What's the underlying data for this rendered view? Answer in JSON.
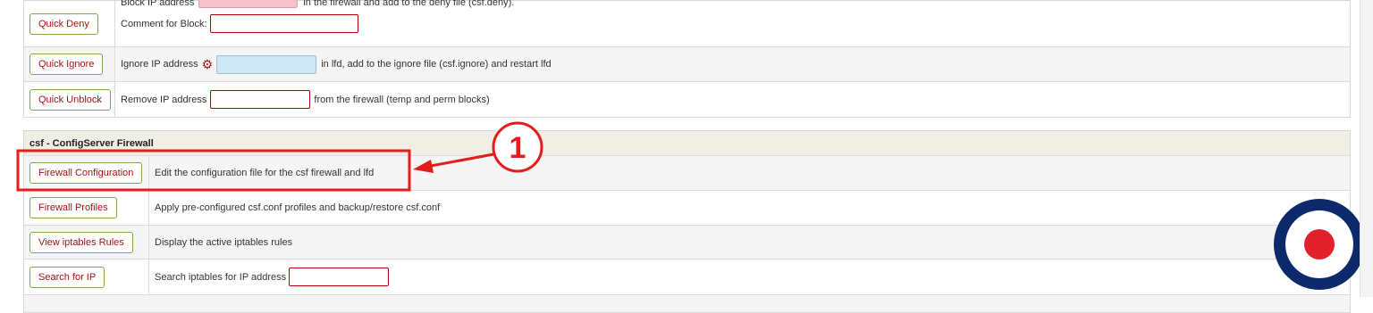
{
  "quick_actions": {
    "deny": {
      "button": "Quick Deny",
      "text_before": "Block IP address",
      "text_after": "in the firewall and add to the deny file (csf.deny).",
      "comment_label": "Comment for Block:"
    },
    "ignore": {
      "button": "Quick Ignore",
      "text_before": "Ignore IP address",
      "text_after": "in lfd, add to the ignore file (csf.ignore) and restart lfd"
    },
    "unblock": {
      "button": "Quick Unblock",
      "text_before": "Remove IP address",
      "text_after": "from the firewall (temp and perm blocks)"
    }
  },
  "csf_section": {
    "title": "csf - ConfigServer Firewall",
    "rows": [
      {
        "button": "Firewall Configuration",
        "desc": "Edit the configuration file for the csf firewall and lfd"
      },
      {
        "button": "Firewall Profiles",
        "desc": "Apply pre-configured csf.conf profiles and backup/restore csf.conf"
      },
      {
        "button": "View iptables Rules",
        "desc": "Display the active iptables rules"
      },
      {
        "button": "Search for IP",
        "desc": "Search iptables for IP address"
      }
    ]
  },
  "annotation": {
    "step_number": "1",
    "color": "#e51c1c"
  },
  "colors": {
    "button_text": "#a41515",
    "button_border": "#7da84e",
    "roundel_blue": "#0c2a6b",
    "roundel_red": "#e0202a"
  },
  "icons": {
    "ignore_settings": "gear-icon"
  }
}
